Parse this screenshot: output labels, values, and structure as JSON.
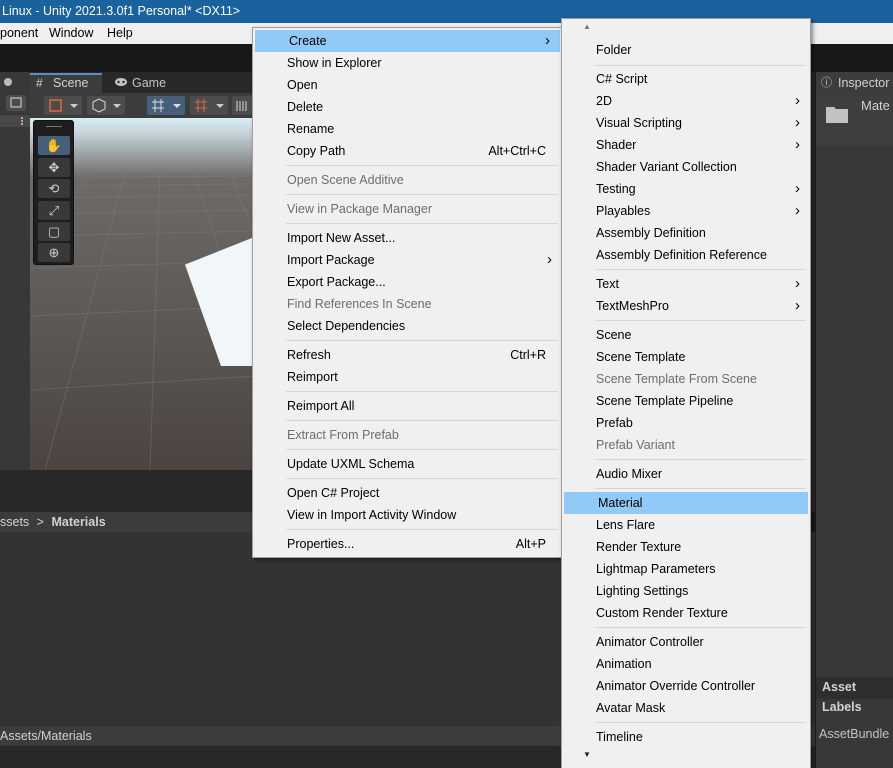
{
  "title_bar": {
    "text": "Linux - Unity 2021.3.0f1 Personal* <DX11>"
  },
  "menubar": {
    "items": [
      "ponent",
      "Window",
      "Help"
    ]
  },
  "scene_view": {
    "tabs": [
      "Scene",
      "Game"
    ],
    "tool_icons": [
      "hand-icon",
      "move-icon",
      "rotate-icon",
      "scale-icon",
      "rect-icon",
      "transform-icon"
    ]
  },
  "project": {
    "breadcrumb": {
      "parent": "ssets",
      "separator": ">",
      "current": "Materials"
    },
    "path": "Assets/Materials"
  },
  "inspector": {
    "tab_label": "Inspector",
    "asset_name": "Mate",
    "asset_labels": "Asset Labels",
    "assetbundle": "AssetBundle"
  },
  "context_menu": {
    "items": [
      {
        "label": "Create",
        "highlighted": true,
        "submenu": true
      },
      {
        "label": "Show in Explorer"
      },
      {
        "label": "Open"
      },
      {
        "label": "Delete"
      },
      {
        "label": "Rename"
      },
      {
        "label": "Copy Path",
        "shortcut": "Alt+Ctrl+C"
      },
      {
        "label": "Open Scene Additive",
        "disabled": true
      },
      {
        "label": "View in Package Manager",
        "disabled": true
      },
      {
        "label": "Import New Asset..."
      },
      {
        "label": "Import Package",
        "submenu": true
      },
      {
        "label": "Export Package..."
      },
      {
        "label": "Find References In Scene",
        "disabled": true
      },
      {
        "label": "Select Dependencies"
      },
      {
        "label": "Refresh",
        "shortcut": "Ctrl+R"
      },
      {
        "label": "Reimport"
      },
      {
        "label": "Reimport All"
      },
      {
        "label": "Extract From Prefab",
        "disabled": true
      },
      {
        "label": "Update UXML Schema"
      },
      {
        "label": "Open C# Project"
      },
      {
        "label": "View in Import Activity Window"
      },
      {
        "label": "Properties...",
        "shortcut": "Alt+P"
      }
    ]
  },
  "create_submenu": {
    "scroll_up": "▲",
    "scroll_down": "▼",
    "items": [
      {
        "label": "Folder"
      },
      {
        "label": "C# Script"
      },
      {
        "label": "2D",
        "submenu": true
      },
      {
        "label": "Visual Scripting",
        "submenu": true
      },
      {
        "label": "Shader",
        "submenu": true
      },
      {
        "label": "Shader Variant Collection"
      },
      {
        "label": "Testing",
        "submenu": true
      },
      {
        "label": "Playables",
        "submenu": true
      },
      {
        "label": "Assembly Definition"
      },
      {
        "label": "Assembly Definition Reference"
      },
      {
        "label": "Text",
        "submenu": true
      },
      {
        "label": "TextMeshPro",
        "submenu": true
      },
      {
        "label": "Scene"
      },
      {
        "label": "Scene Template"
      },
      {
        "label": "Scene Template From Scene",
        "disabled": true
      },
      {
        "label": "Scene Template Pipeline"
      },
      {
        "label": "Prefab"
      },
      {
        "label": "Prefab Variant",
        "disabled": true
      },
      {
        "label": "Audio Mixer"
      },
      {
        "label": "Material",
        "highlighted": true
      },
      {
        "label": "Lens Flare"
      },
      {
        "label": "Render Texture"
      },
      {
        "label": "Lightmap Parameters"
      },
      {
        "label": "Lighting Settings"
      },
      {
        "label": "Custom Render Texture"
      },
      {
        "label": "Animator Controller"
      },
      {
        "label": "Animation"
      },
      {
        "label": "Animator Override Controller"
      },
      {
        "label": "Avatar Mask"
      },
      {
        "label": "Timeline"
      }
    ]
  },
  "colors": {
    "highlight": "#91c9f7",
    "titlebar": "#19629e",
    "editor_bg": "#383838",
    "menu_bg": "#f0f0f0"
  }
}
